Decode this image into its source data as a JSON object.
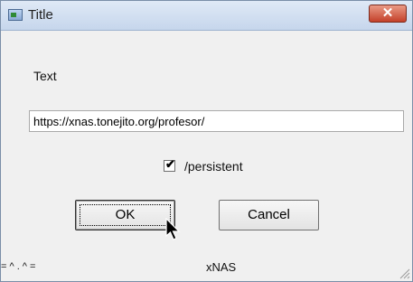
{
  "window": {
    "title": "Title",
    "close_symbol": "✕",
    "icon": "app-window-icon"
  },
  "content": {
    "label": "Text",
    "url_value": "https://xnas.tonejito.org/profesor/",
    "checkbox": {
      "label": "/persistent",
      "checked": true
    }
  },
  "buttons": {
    "ok_label": "OK",
    "cancel_label": "Cancel"
  },
  "footer": {
    "left_text": "= ^ . ^ =",
    "right_text": "xNAS"
  },
  "colors": {
    "close_button": "#c4412a",
    "titlebar": "#c6d6ec",
    "window_bg": "#f0f0f0"
  },
  "icons": [
    "app-window-icon",
    "close-icon",
    "check-icon",
    "mouse-cursor-icon",
    "resize-grip-icon"
  ]
}
